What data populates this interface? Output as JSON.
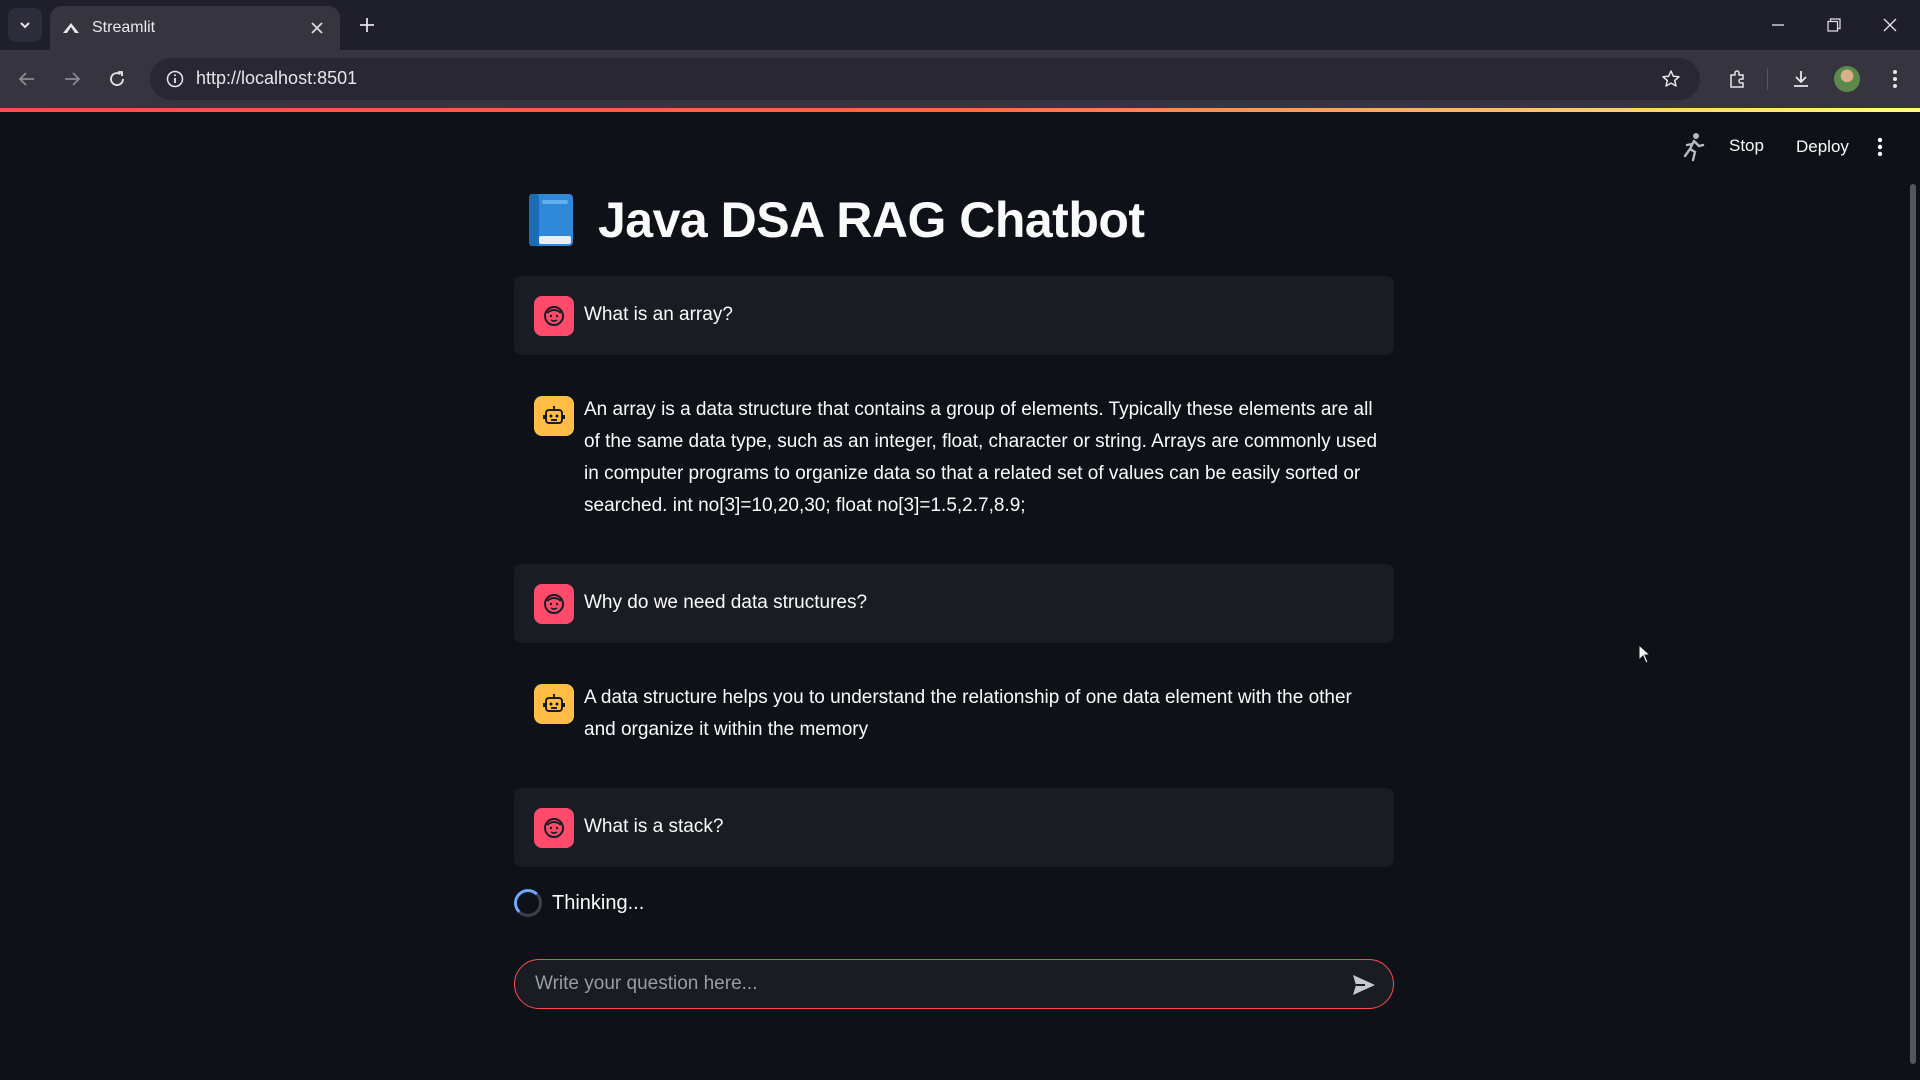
{
  "browser": {
    "tab_title": "Streamlit",
    "url": "http://localhost:8501"
  },
  "app_header": {
    "stop_label": "Stop",
    "deploy_label": "Deploy"
  },
  "page": {
    "title_emoji_icon": "blue-book-icon",
    "title": "Java DSA RAG Chatbot"
  },
  "messages": [
    {
      "role": "user",
      "avatar_icon": "user-face-icon",
      "text": "What is an array?"
    },
    {
      "role": "assistant",
      "avatar_icon": "robot-icon",
      "text": "An array is a data structure that contains a group of elements. Typically these elements are all of the same data type, such as an integer, float, character or string. Arrays are commonly used in computer programs to organize data so that a related set of values can be easily sorted or searched. int no[3]=10,20,30; float no[3]=1.5,2.7,8.9;"
    },
    {
      "role": "user",
      "avatar_icon": "user-face-icon",
      "text": "Why do we need data structures?"
    },
    {
      "role": "assistant",
      "avatar_icon": "robot-icon",
      "text": "A data structure helps you to understand the relationship of one data element with the other and organize it within the memory"
    },
    {
      "role": "user",
      "avatar_icon": "user-face-icon",
      "text": "What is a stack?"
    }
  ],
  "status": {
    "thinking_text": "Thinking..."
  },
  "chat_input": {
    "placeholder": "Write your question here...",
    "value": ""
  },
  "colors": {
    "background": "#0e1117",
    "user_message_bg": "#1a1c24",
    "user_avatar": "#ff4b6b",
    "bot_avatar": "#ffbd45",
    "accent": "#ff4b4b"
  }
}
